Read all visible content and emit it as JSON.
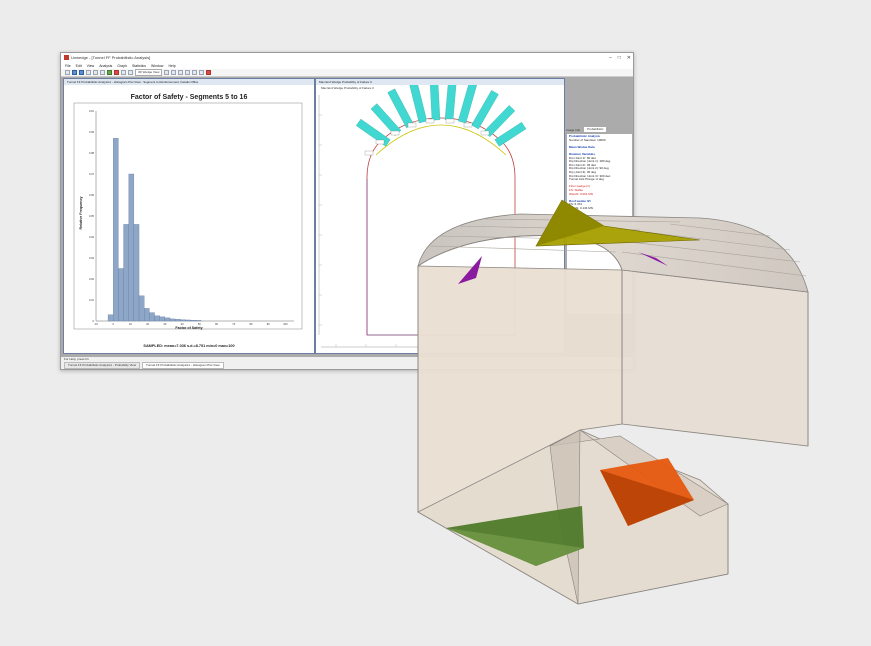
{
  "window": {
    "title": "Unwedge - [Tunnel FF Probabilistic Analysis]",
    "controls": [
      "–",
      "□",
      "✕"
    ]
  },
  "menu": [
    "File",
    "Edit",
    "View",
    "Analysis",
    "Graph",
    "Statistics",
    "Window",
    "Help"
  ],
  "toolbar": {
    "dropdown_label": "3D Wedge View"
  },
  "histogram_window": {
    "title": "Tunnel FF Probabilistic Analysis1 - Histogram Plot View : Segment to Reinforcement, Details Office",
    "chart_title": "Factor of Safety  - Segments 5 to 16",
    "xlabel": "Factor of Safety",
    "ylabel": "Relative Frequency",
    "y_ticks": [
      "0.10",
      "0.09",
      "0.08",
      "0.07",
      "0.06",
      "0.05",
      "0.04",
      "0.03",
      "0.02",
      "0.01",
      "0"
    ],
    "x_ticks": [
      "-10",
      "0",
      "10",
      "20",
      "30",
      "40",
      "50",
      "60",
      "70",
      "80",
      "90",
      "100"
    ],
    "summary": "SAMPLED: mean=7.036 s.d.=8.751 min=0 max=100"
  },
  "chart_data": {
    "type": "bar",
    "title": "Factor of Safety  - Segments 5 to 16",
    "xlabel": "Factor of Safety",
    "ylabel": "Relative Frequency",
    "ylim": [
      0,
      0.1
    ],
    "xlim": [
      -10,
      105
    ],
    "bin_starts": [
      -3,
      0,
      3,
      6,
      9,
      12,
      15,
      18,
      21,
      24,
      27,
      30,
      33,
      36,
      39,
      42,
      45,
      48
    ],
    "bin_width": 3,
    "values": [
      0.003,
      0.087,
      0.025,
      0.046,
      0.07,
      0.046,
      0.012,
      0.006,
      0.004,
      0.0025,
      0.002,
      0.0015,
      0.001,
      0.0008,
      0.0006,
      0.0005,
      0.0004,
      0.0003
    ],
    "grid": false
  },
  "wedge_window": {
    "title": "Max End Wedge Probability of Failure 0",
    "subtitle": "Max End Wedge Probability of Failure 0"
  },
  "info_panel": {
    "label": "Image Info",
    "dropdown": "Probabilistic",
    "lines": [
      {
        "text": "Probabilistic Analysis",
        "style": "h"
      },
      {
        "text": "Number of Samples: 10000",
        "style": ""
      },
      {
        "text": "",
        "style": ""
      },
      {
        "text": "Mean Wedge Data",
        "style": "h"
      },
      {
        "text": "",
        "style": ""
      },
      {
        "text": "Random Variables",
        "style": "h"
      },
      {
        "text": "Dip (Joint 1): 60 deg",
        "style": ""
      },
      {
        "text": "Dip Direction (Joint 1): 180 deg",
        "style": ""
      },
      {
        "text": "Dip (Joint 2): 45 deg",
        "style": ""
      },
      {
        "text": "Dip Direction (Joint 2): 90 deg",
        "style": ""
      },
      {
        "text": "Dip (Joint 3): 45 deg",
        "style": ""
      },
      {
        "text": "Dip Direction (Joint 3): 300 deg",
        "style": ""
      },
      {
        "text": "Tunnel Axis Plunge: 0 deg",
        "style": ""
      },
      {
        "text": "",
        "style": ""
      },
      {
        "text": "Floor wedge [1]",
        "style": "red"
      },
      {
        "text": "FS: Stable",
        "style": "red"
      },
      {
        "text": "Weight: 0.061 MN",
        "style": "red"
      },
      {
        "text": "",
        "style": ""
      },
      {
        "text": "Roof wedge [2]",
        "style": "h"
      },
      {
        "text": "FS: 6.472",
        "style": ""
      },
      {
        "text": "Weight: 0.134 MN",
        "style": ""
      }
    ]
  },
  "status": {
    "line": "For Help, press F1",
    "tabs": [
      "Tunnel FF Probabilistic Analysis1 - Probability View",
      "Tunnel FF Probabilistic Analysis1 - Histogram Plot View"
    ]
  },
  "colors": {
    "histogram_bar": "#8ea6c8",
    "roof_wedge": "#a8a000",
    "floor_wedge_left": "#4f7a2a",
    "floor_wedge_right": "#e6590f",
    "side_wedges": "#8a1aa0",
    "tunnel": "#e9dfd3",
    "wedge_bars": "#40d8d0"
  }
}
